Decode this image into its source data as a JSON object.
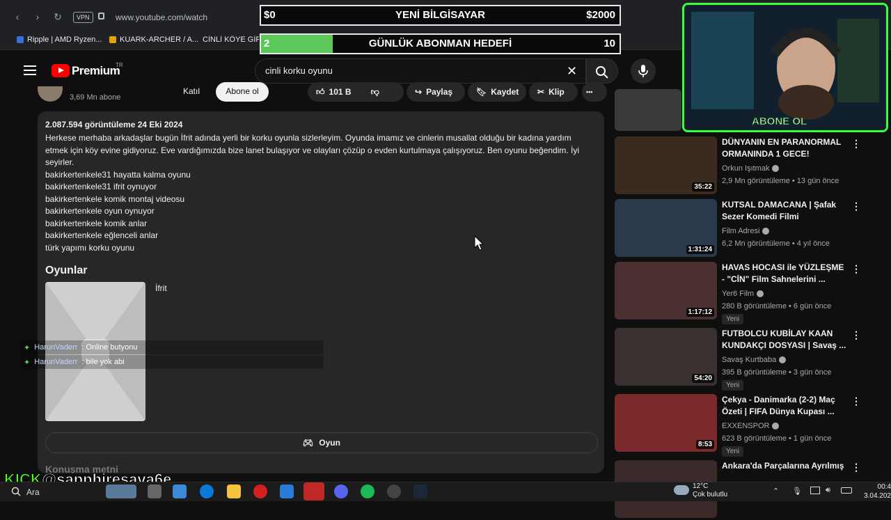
{
  "browser": {
    "vpn": "VPN",
    "url": "www.youtube.com/watch",
    "bookmarks": [
      "Ripple | AMD Ryzen...",
      "KUARK-ARCHER / A...",
      "CİNLİ KÖYE GİR"
    ]
  },
  "overlay": {
    "bar1": {
      "left": "$0",
      "center": "YENİ BİLGİSAYAR",
      "right": "$2000"
    },
    "bar2": {
      "left": "2",
      "center": "GÜNLÜK ABONMAN HEDEFİ",
      "right": "10",
      "progress": 0.2
    },
    "kick_prefix": "KICK",
    "kick_handle": "@sapphiresava6e",
    "webcam_label": "ABONE OL"
  },
  "youtube": {
    "logo_text": "Premium",
    "region": "TR",
    "search_value": "cinli korku oyunu",
    "subscribers": "3,69 Mn abone",
    "join_label": "Katıl",
    "subscribe_label": "Abone ol",
    "like_count": "101 B",
    "share_label": "Paylaş",
    "save_label": "Kaydet",
    "clip_label": "Klip",
    "kebab": "•••"
  },
  "description": {
    "meta": "2.087.594 görüntüleme  24 Eki 2024",
    "body": "Herkese merhaba arkadaşlar bugün İfrit adında yerli bir korku oyunla sizlerleyim. Oyunda imamız ve cinlerin musallat olduğu bir kadına yardım etmek için köy evine gidiyoruz. Eve vardığımızda bize lanet bulaşıyor ve olayları çözüp o evden kurtulmaya çalışıyoruz. Ben oyunu beğendim. İyi seyirler.",
    "lines": [
      "bakirkertenkele31 hayatta kalma oyunu",
      "bakirkertenkele31 ifrit oynuyor",
      "bakirkertenkele komik montaj videosu",
      "bakirkertenkele oyun oynuyor",
      "bakirkertenkele komik anlar",
      "bakirkertenkele eğlenceli anlar",
      "türk yapımı korku oyunu"
    ],
    "games_title": "Oyunlar",
    "game_name": "İfrit",
    "game_button": "Oyun",
    "more_section": "Konuşma metni"
  },
  "chat": [
    {
      "user": "HarunVaderr",
      "message": ": Online butyonu"
    },
    {
      "user": "HarunVaderr",
      "message": ": bile yok abi"
    }
  ],
  "recommendations": [
    {
      "title": "DÜNYANIN EN PARANORMAL ORMANINDA 1 GECE!",
      "channel": "Orkun Işıtmak",
      "meta": "2,9 Mn görüntüleme • 13 gün önce",
      "duration": "35:22",
      "badge": "",
      "color": "#3a2a20"
    },
    {
      "title": "KUTSAL DAMACANA | Şafak Sezer Komedi Filmi",
      "channel": "Film Adresi",
      "meta": "6,2 Mn görüntüleme • 4 yıl önce",
      "duration": "1:31:24",
      "badge": "",
      "color": "#2a3a4a"
    },
    {
      "title": "HAVAS HOCASI ile YÜZLEŞME - \"CİN\" Film Sahnelerini ...",
      "channel": "Yer6 Film",
      "meta": "280 B görüntüleme • 6 gün önce",
      "duration": "1:17:12",
      "badge": "Yeni",
      "color": "#4a3030"
    },
    {
      "title": "FUTBOLCU KUBİLAY KAAN KUNDAKÇI DOSYASI | Savaş ...",
      "channel": "Savaş Kurtbaba",
      "meta": "395 B görüntüleme • 3 gün önce",
      "duration": "54:20",
      "badge": "Yeni",
      "color": "#3a3030"
    },
    {
      "title": "Çekya - Danimarka (2-2) Maç Özeti | FIFA Dünya Kupası ...",
      "channel": "EXXENSPOR",
      "meta": "623 B görüntüleme • 1 gün önce",
      "duration": "8:53",
      "badge": "Yeni",
      "color": "#7a2a2a"
    },
    {
      "title": "Ankara'da Parçalarına Ayrılmış",
      "channel": "",
      "meta": "",
      "duration": "",
      "badge": "",
      "color": "#3a2a2a"
    }
  ],
  "taskbar": {
    "search": "Ara",
    "weather_temp": "12°C",
    "weather_desc": "Çok bulutlu",
    "time": "00:4",
    "date": "3.04.202"
  }
}
